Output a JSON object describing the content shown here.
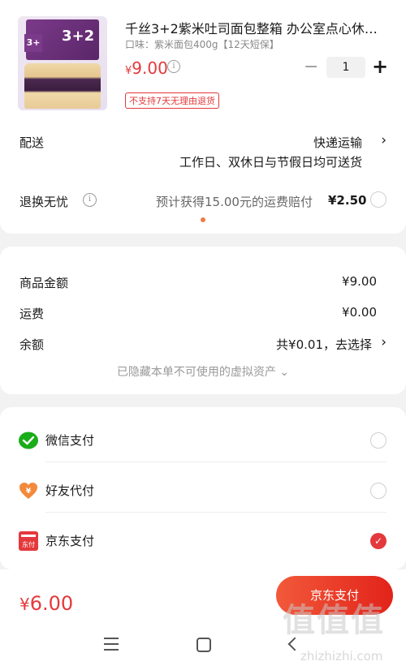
{
  "product": {
    "title": "千丝3+2紫米吐司面包整箱 办公室点心休…",
    "spec": "口味：紫米面包400g【12天短保】",
    "price_symbol": "¥",
    "price_value": "9.00",
    "quantity": "1",
    "minus": "−",
    "plus": "+",
    "no_return_tag": "不支持7天无理由退货",
    "thumb_text": "3+2",
    "thumb_badge": "3+"
  },
  "shipping": {
    "label": "配送",
    "method": "快递运输",
    "desc": "工作日、双休日与节假日均可送货"
  },
  "returns": {
    "label": "退换无忧",
    "desc": "预计获得15.00元的运费赔付",
    "price": "¥2.50"
  },
  "amounts": {
    "goods_label": "商品金额",
    "goods_value": "¥9.00",
    "freight_label": "运费",
    "freight_value": "¥0.00",
    "balance_label": "余额",
    "balance_value": "共¥0.01，去选择",
    "hidden_assets": "已隐藏本单不可使用的虚拟资产 ⌄"
  },
  "payment": {
    "options": [
      {
        "label": "微信支付",
        "icon": "wechat-pay-icon",
        "selected": false
      },
      {
        "label": "好友代付",
        "icon": "friend-pay-icon",
        "selected": false
      },
      {
        "label": "京东支付",
        "icon": "jd-pay-icon",
        "selected": true
      }
    ],
    "jd_icon_text": "东付"
  },
  "footer": {
    "total_symbol": "¥",
    "total_value": "6.00",
    "pay_button": "京东支付"
  },
  "watermark": {
    "text": "值值值",
    "url": "zhizhizhi.com"
  },
  "colors": {
    "accent": "#e4393c",
    "wechat": "#1aad19"
  }
}
